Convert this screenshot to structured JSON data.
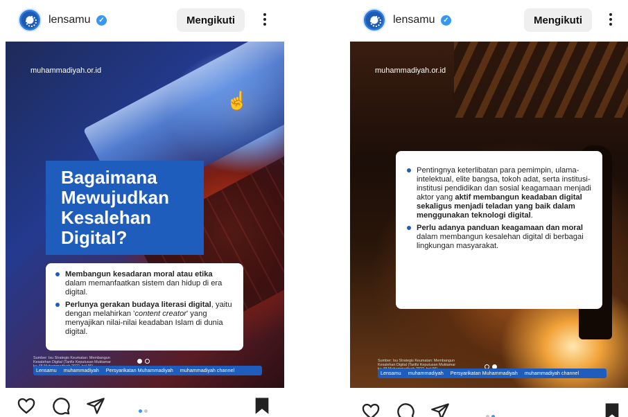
{
  "posts": [
    {
      "account": {
        "username": "lensamu",
        "verified_icon": "verified-badge-icon"
      },
      "follow_label": "Mengikuti",
      "image": {
        "site_url": "muhammadiyah.or.id",
        "title_lines": [
          "Bagaimana",
          "Mewujudkan",
          "Kesalehan",
          "Digital?"
        ],
        "bullets": [
          {
            "bold": "Membangun kesadaran moral atau etika",
            "rest": " dalam memanfaatkan sistem dan hidup di era digital."
          },
          {
            "bold": "Perlunya gerakan budaya literasi digital",
            "rest": ", yaitu dengan melahirkan '",
            "italic": "content creator",
            "tail": "' yang menyajikan nilai-nilai keadaban Islam di dunia digital."
          }
        ],
        "source_note": "Sumber: Isu Strategis Keumatan: Membangun Kesalehan Digital (Tanfiz Keputusan Muktamar ke-48 Muhammadiyah 2022, hal 96)",
        "footer": [
          "Lensamu",
          "muhammadiyah",
          "Persyarikatan Muhammadiyah",
          "muhammadiyah channel"
        ],
        "page_index": 1,
        "page_count": 2
      },
      "carousel": {
        "current": 1,
        "total": 2
      }
    },
    {
      "account": {
        "username": "lensamu",
        "verified_icon": "verified-badge-icon"
      },
      "follow_label": "Mengikuti",
      "image": {
        "site_url": "muhammadiyah.or.id",
        "bullets": [
          {
            "pre": "Pentingnya keterlibatan para pemimpin, ulama-intelektual, elite bangsa, tokoh adat, serta institusi-institusi pendidikan dan sosial keagamaan menjadi aktor yang ",
            "bold": "aktif membangun keadaban digital sekaligus menjadi teladan yang baik dalam menggunakan teknologi digital",
            "rest": "."
          },
          {
            "bold": "Perlu adanya panduan keagamaan dan moral",
            "rest": " dalam membangun kesalehan digital di berbagai lingkungan masyarakat."
          }
        ],
        "source_note": "Sumber: Isu Strategis Keumatan: Membangun Kesalehan Digital (Tanfiz Keputusan Muktamar ke-48 Muhammadiyah 2022, hal 96)",
        "footer": [
          "Lensamu",
          "muhammadiyah",
          "Persyarikatan Muhammadiyah",
          "muhammadiyah channel"
        ],
        "page_index": 2,
        "page_count": 2
      },
      "carousel": {
        "current": 2,
        "total": 2
      }
    }
  ],
  "icons": [
    "heart-icon",
    "comment-icon",
    "share-icon",
    "bookmark-icon",
    "kebab-menu-icon",
    "hand-cursor-icon"
  ],
  "colors": {
    "accent_blue": "#1f5dbd",
    "follow_bg": "#efefef",
    "dot_active": "#3897f0"
  }
}
